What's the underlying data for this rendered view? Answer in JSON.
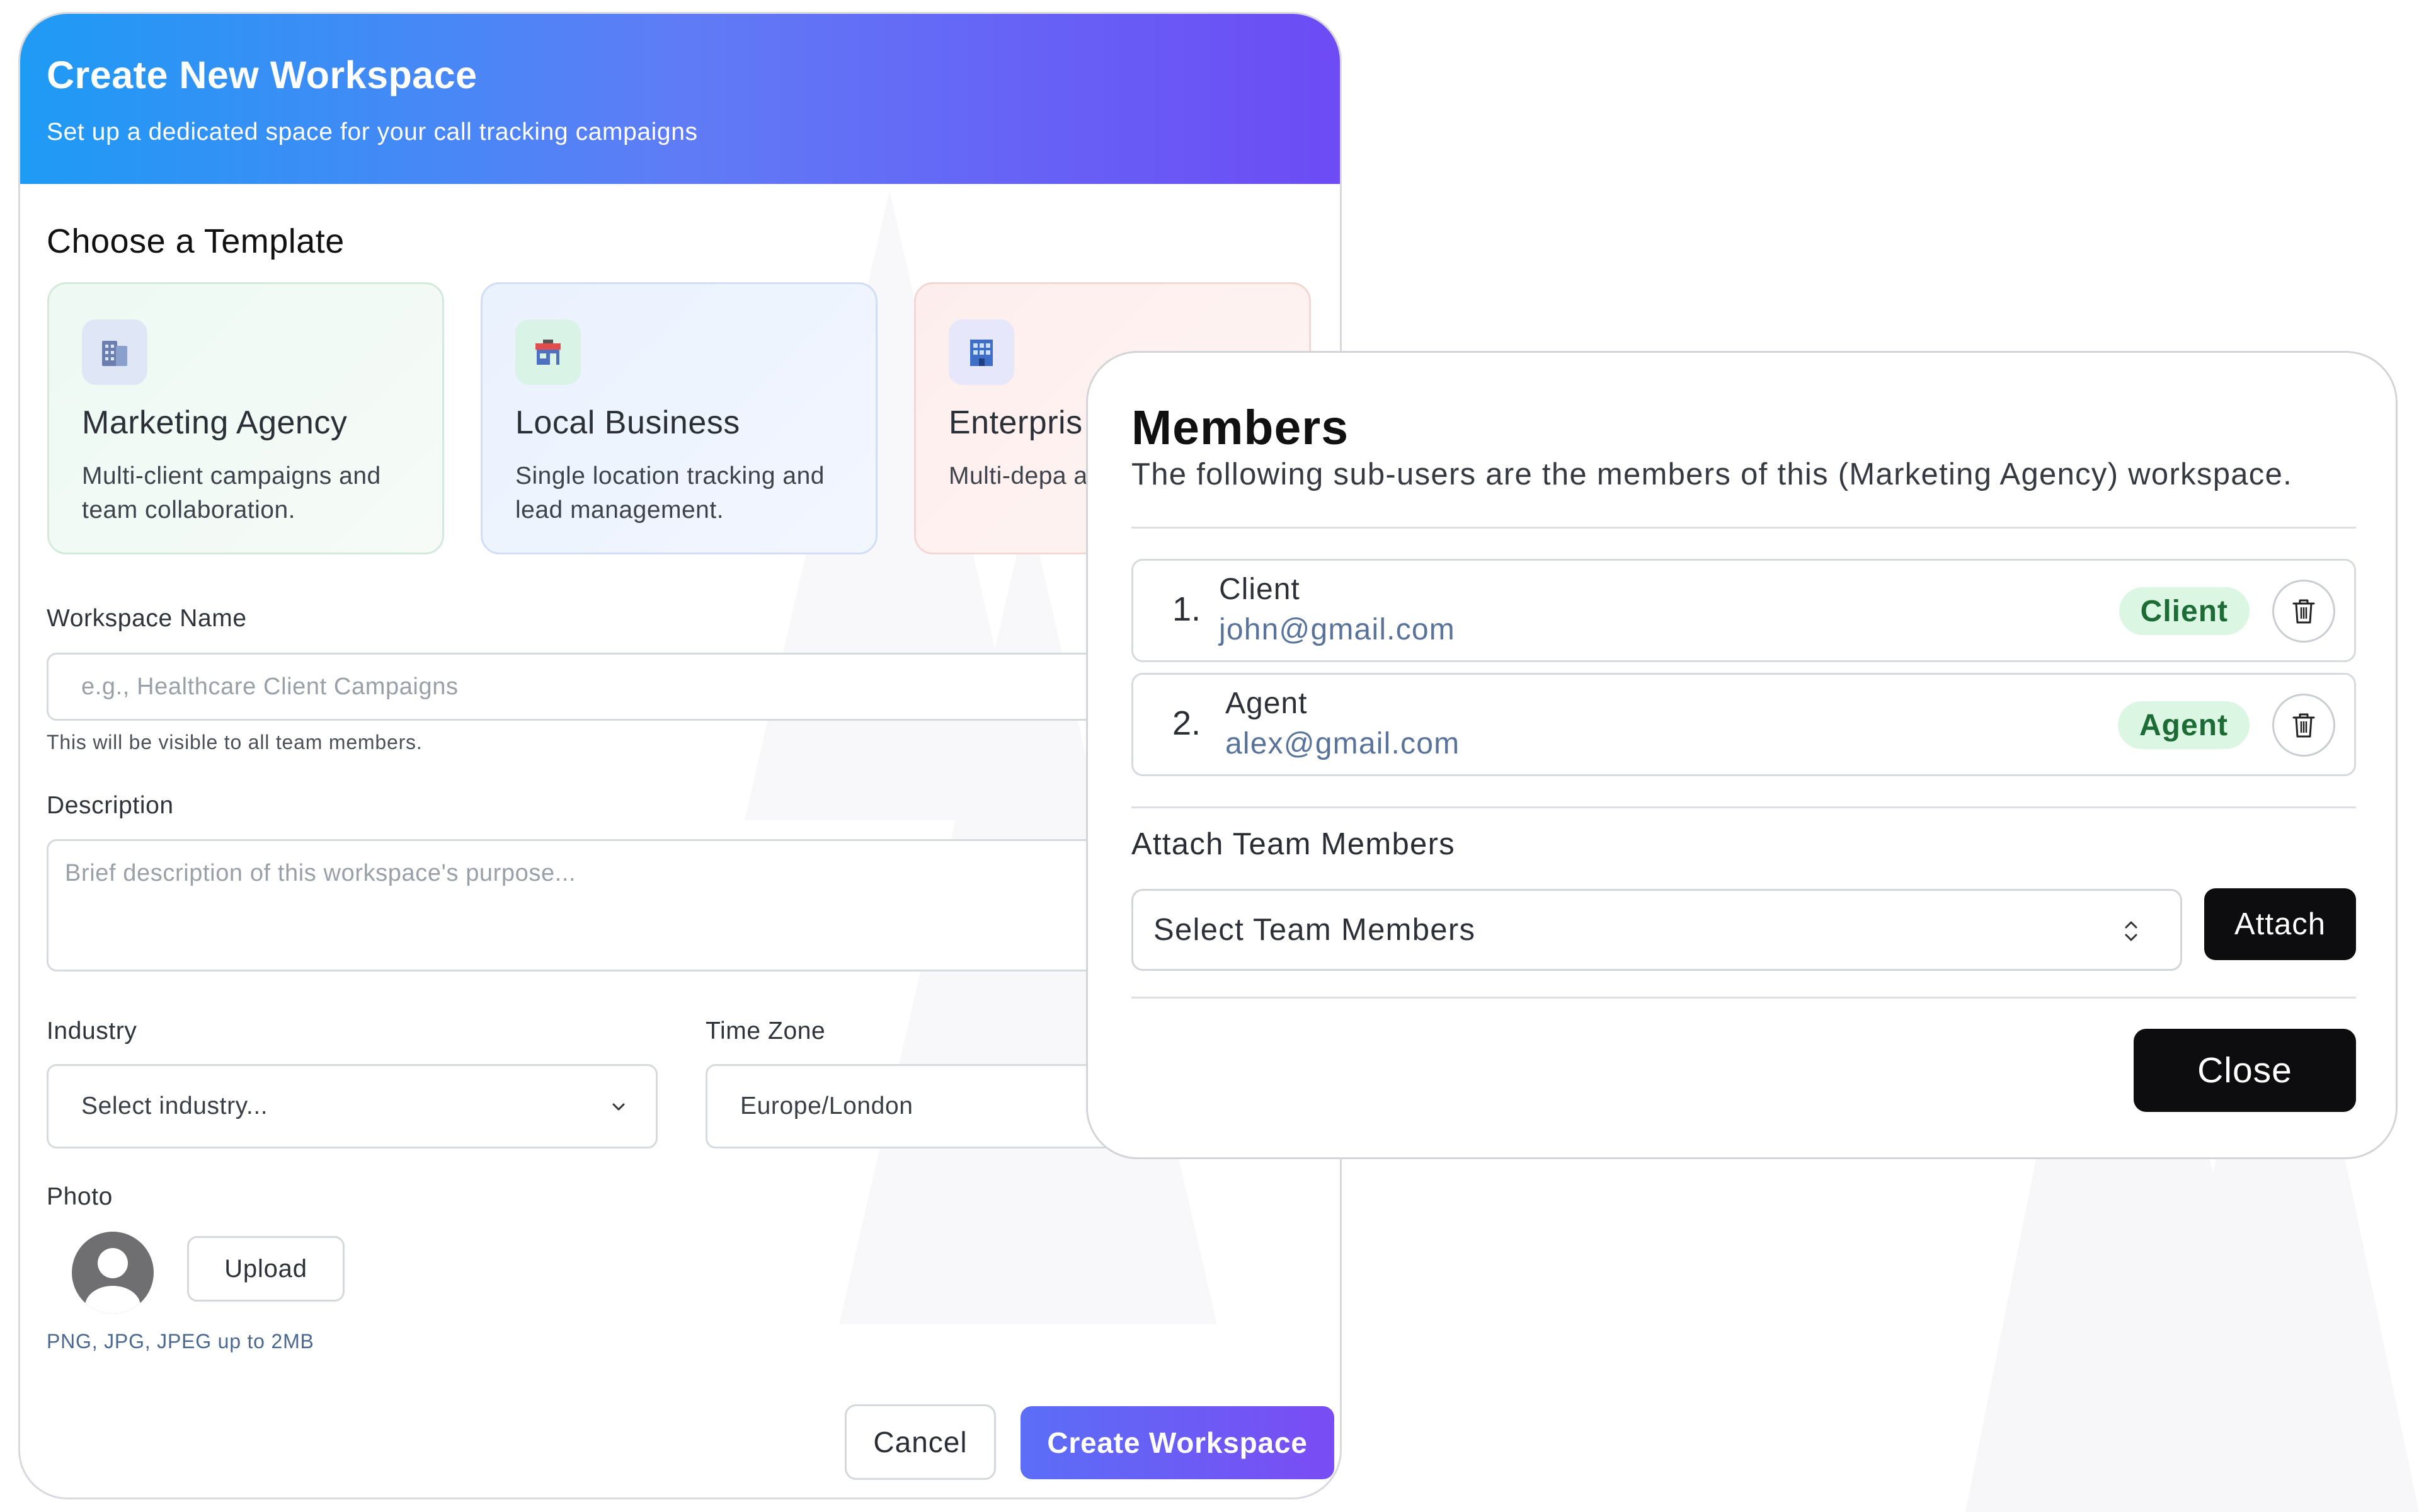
{
  "workspace_dialog": {
    "title": "Create New Workspace",
    "subtitle": "Set up a dedicated space for your call tracking campaigns",
    "templates_heading": "Choose a Template",
    "templates": [
      {
        "name": "Marketing Agency",
        "description": "Multi-client campaigns and team collaboration.",
        "icon": "office-building-icon"
      },
      {
        "name": "Local Business",
        "description": "Single location tracking and lead management.",
        "icon": "storefront-icon"
      },
      {
        "name": "Enterpris",
        "description": "Multi-depa advanced a",
        "icon": "enterprise-building-icon"
      }
    ],
    "workspace_name": {
      "label": "Workspace Name",
      "placeholder": "e.g., Healthcare Client Campaigns",
      "value": "",
      "helper": "This will be visible to all team members."
    },
    "description": {
      "label": "Description",
      "placeholder": "Brief description of this workspace's purpose...",
      "value": ""
    },
    "industry": {
      "label": "Industry",
      "selected": "Select industry..."
    },
    "time_zone": {
      "label": "Time Zone",
      "selected": "Europe/London"
    },
    "photo": {
      "label": "Photo",
      "upload_label": "Upload",
      "helper": "PNG, JPG, JPEG up to 2MB"
    },
    "cancel_label": "Cancel",
    "create_label": "Create Workspace",
    "colors": {
      "header_start": "#1e9bf5",
      "header_end": "#6d4bf5",
      "primary": "#6d4bf5"
    }
  },
  "members_modal": {
    "title": "Members",
    "description": "The following sub-users are the members of this (Marketing Agency) workspace.",
    "members": [
      {
        "index": "1.",
        "name": "Client",
        "email": "john@gmail.com",
        "role": "Client"
      },
      {
        "index": "2.",
        "name": "Agent",
        "email": "alex@gmail.com",
        "role": "Agent"
      }
    ],
    "attach_label": "Attach Team Members",
    "select_placeholder": "Select Team Members",
    "attach_button": "Attach",
    "close_button": "Close",
    "colors": {
      "badge_bg": "#dcf6e4",
      "badge_text": "#1d6b35",
      "email": "#5a739a",
      "button": "#0d0d0f"
    }
  }
}
